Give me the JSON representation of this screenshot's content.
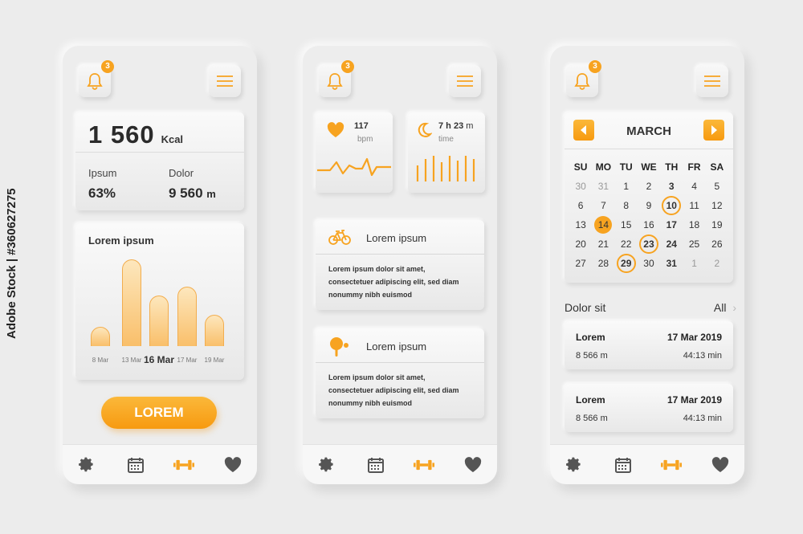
{
  "side_id": "Adobe Stock | #360627275",
  "colors": {
    "accent": "#f7a320",
    "background": "#ececec",
    "card": "#f4f4f4"
  },
  "header": {
    "badge_count": "3",
    "bell_icon": "bell-icon",
    "menu_icon": "hamburger-menu-icon"
  },
  "nav": [
    "gear-icon",
    "calendar-icon",
    "dumbbell-icon",
    "heart-icon"
  ],
  "screen1": {
    "kcal_value": "1 560",
    "kcal_unit": "Kcal",
    "stat1_label": "Ipsum",
    "stat1_value": "63%",
    "stat2_label": "Dolor",
    "stat2_value": "9 560",
    "stat2_unit": "m",
    "cta_label": "LOREM"
  },
  "chart_data": {
    "type": "bar",
    "title": "Lorem ipsum",
    "categories": [
      "8 Mar",
      "13 Mar",
      "16 Mar",
      "17 Mar",
      "19 Mar"
    ],
    "values": [
      24,
      110,
      64,
      75,
      40
    ],
    "highlighted": "16 Mar",
    "ylim": [
      0,
      120
    ]
  },
  "screen2": {
    "heart_value": "117",
    "heart_unit": "bpm",
    "sleep_value": "7 h 23",
    "sleep_value_unit": "m",
    "sleep_unit": "time",
    "activity1_title": "Lorem ipsum",
    "activity1_text": "Lorem ipsum dolor sit amet, consectetuer adipiscing elit, sed diam nonummy nibh euismod",
    "activity2_title": "Lorem ipsum",
    "activity2_text": "Lorem ipsum dolor sit amet, consectetuer adipiscing elit, sed diam nonummy nibh euismod"
  },
  "screen3": {
    "month": "MARCH",
    "weekdays": [
      "SU",
      "MO",
      "TU",
      "WE",
      "TH",
      "FR",
      "SA"
    ],
    "weeks": [
      [
        {
          "d": "30",
          "s": "dim"
        },
        {
          "d": "31",
          "s": "dim"
        },
        {
          "d": "1"
        },
        {
          "d": "2"
        },
        {
          "d": "3",
          "s": "bold"
        },
        {
          "d": "4"
        },
        {
          "d": "5"
        }
      ],
      [
        {
          "d": "6"
        },
        {
          "d": "7"
        },
        {
          "d": "8"
        },
        {
          "d": "9"
        },
        {
          "d": "10",
          "s": "ring"
        },
        {
          "d": "11"
        },
        {
          "d": "12"
        }
      ],
      [
        {
          "d": "13"
        },
        {
          "d": "14",
          "s": "fill"
        },
        {
          "d": "15"
        },
        {
          "d": "16"
        },
        {
          "d": "17",
          "s": "bold"
        },
        {
          "d": "18"
        },
        {
          "d": "19"
        }
      ],
      [
        {
          "d": "20"
        },
        {
          "d": "21"
        },
        {
          "d": "22"
        },
        {
          "d": "23",
          "s": "ring"
        },
        {
          "d": "24",
          "s": "bold"
        },
        {
          "d": "25"
        },
        {
          "d": "26"
        }
      ],
      [
        {
          "d": "27"
        },
        {
          "d": "28"
        },
        {
          "d": "29",
          "s": "ring"
        },
        {
          "d": "30"
        },
        {
          "d": "31",
          "s": "bold"
        },
        {
          "d": "1",
          "s": "dim"
        },
        {
          "d": "2",
          "s": "dim"
        }
      ]
    ],
    "list_title": "Dolor sit",
    "list_all": "All",
    "entries": [
      {
        "name": "Lorem",
        "date": "17 Mar 2019",
        "distance": "8 566 m",
        "duration": "44:13 min"
      },
      {
        "name": "Lorem",
        "date": "17 Mar 2019",
        "distance": "8 566 m",
        "duration": "44:13 min"
      }
    ]
  }
}
